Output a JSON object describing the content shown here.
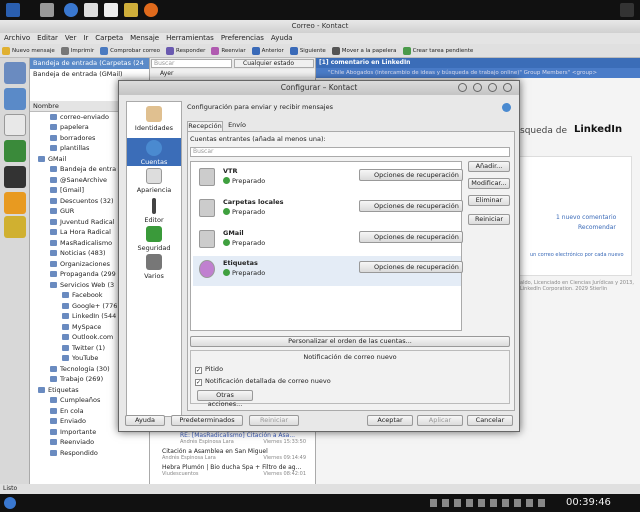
{
  "window": {
    "title": "Correo - Kontact",
    "menu": [
      "Archivo",
      "Editar",
      "Ver",
      "Ir",
      "Carpeta",
      "Mensaje",
      "Herramientas",
      "Preferencias",
      "Ayuda"
    ],
    "toolbar": [
      "Nuevo mensaje",
      "Imprimir",
      "Comprobar correo",
      "Responder",
      "Reenviar",
      "Anterior",
      "Siguiente",
      "Mover a la papelera",
      "Crear tarea pendiente"
    ]
  },
  "folder_header": "Bandeja de entrada (Carpetas",
  "folder_count": "(24",
  "folder_header2": "Bandeja de entrada (GMail)",
  "folder_col": "Nombre",
  "folders": [
    {
      "label": "correo-enviado",
      "indent": 1
    },
    {
      "label": "papelera",
      "indent": 1
    },
    {
      "label": "borradores",
      "indent": 1
    },
    {
      "label": "plantillas",
      "indent": 1
    },
    {
      "label": "GMail",
      "indent": 0
    },
    {
      "label": "Bandeja de entra",
      "indent": 1
    },
    {
      "label": "@SaneArchive",
      "indent": 1
    },
    {
      "label": "[Gmail]",
      "indent": 1
    },
    {
      "label": "Descuentos (32)",
      "indent": 1
    },
    {
      "label": "GUR",
      "indent": 1
    },
    {
      "label": "Juventud Radical",
      "indent": 1
    },
    {
      "label": "La Hora Radical",
      "indent": 1
    },
    {
      "label": "MasRadicalismo",
      "indent": 1
    },
    {
      "label": "Noticias (483)",
      "indent": 1
    },
    {
      "label": "Organizaciones",
      "indent": 1
    },
    {
      "label": "Propaganda (299",
      "indent": 1
    },
    {
      "label": "Servicios Web (3",
      "indent": 1
    },
    {
      "label": "Facebook",
      "indent": 2
    },
    {
      "label": "Google+ (776)",
      "indent": 2
    },
    {
      "label": "LinkedIn (544",
      "indent": 2
    },
    {
      "label": "MySpace",
      "indent": 2
    },
    {
      "label": "Outlook.com",
      "indent": 2
    },
    {
      "label": "Twitter (1)",
      "indent": 2
    },
    {
      "label": "YouTube",
      "indent": 2
    },
    {
      "label": "Tecnología (30)",
      "indent": 1
    },
    {
      "label": "Trabajo (269)",
      "indent": 1
    },
    {
      "label": "Etiquetas",
      "indent": 0
    },
    {
      "label": "Cumpleaños",
      "indent": 1
    },
    {
      "label": "En cola",
      "indent": 1
    },
    {
      "label": "Enviado",
      "indent": 1
    },
    {
      "label": "Importante",
      "indent": 1
    },
    {
      "label": "Reenviado",
      "indent": 1
    },
    {
      "label": "Respondido",
      "indent": 1
    }
  ],
  "search": {
    "placeholder": "Buscar",
    "state": "Cualquier estado"
  },
  "msg_group": "Ayer",
  "messages": [
    {
      "subject": "RE: [MasRadicalismo] Citación a Asa...",
      "from": "Andrés Espinosa Lara",
      "date": "Viernes 15:33:50"
    },
    {
      "subject": "Citación a Asamblea en San Miguel",
      "from": "Andrés Espinosa Lara",
      "date": "Viernes 09:14:49"
    },
    {
      "subject": "Hebra Plumón | Bio ducha Spa + Filtro de ag...",
      "from": "Viudescuentos",
      "date": "Viernes 08:42:01"
    }
  ],
  "preview": {
    "header": "[1] comentario en LinkedIn",
    "from_line": "\"Chile Abogados (intercambio de ideas y búsqueda de trabajo online)\" Group Members\" <group>",
    "search_text": "squeda de",
    "brand": "LinkedIn",
    "comment": "1 nuevo comentario",
    "recommend": "Recomendar",
    "email_pref": "un correo electrónico por cada nuevo",
    "footer": "aldo, Licenciado en Ciencias Jurídicas y 2013, LinkedIn Corporation. 2029 Stierlin"
  },
  "status": "Listo",
  "clock": "00:39:46",
  "dialog": {
    "title": "Configurar – Kontact",
    "heading": "Configuración para enviar y recibir mensajes",
    "tabs": [
      "Recepción",
      "Envío"
    ],
    "accounts_label": "Cuentas entrantes (añada al menos una):",
    "search_placeholder": "Buscar",
    "nav": [
      "Identidades",
      "Cuentas",
      "Apariencia",
      "Editor",
      "Seguridad",
      "Varios"
    ],
    "accounts": [
      {
        "name": "VTR",
        "state": "Preparado",
        "option": "Opciones de recuperación"
      },
      {
        "name": "Carpetas locales",
        "state": "Preparado",
        "option": "Opciones de recuperación"
      },
      {
        "name": "GMail",
        "state": "Preparado",
        "option": "Opciones de recuperación"
      },
      {
        "name": "Etiquetas",
        "state": "Preparado",
        "option": "Opciones de recuperación"
      }
    ],
    "side_buttons": [
      "Añadir...",
      "Modificar...",
      "Eliminar",
      "Reiniciar"
    ],
    "customize": "Personalizar el orden de las cuentas...",
    "notif_title": "Notificación de correo nuevo",
    "notif_beep": "Pitido",
    "notif_detail": "Notificación detallada de correo nuevo",
    "other_actions": "Otras acciones...",
    "footer_left": [
      "Ayuda",
      "Predeterminados",
      "Reiniciar"
    ],
    "footer_right": [
      "Aceptar",
      "Aplicar",
      "Cancelar"
    ]
  },
  "colors": {
    "accent": "#3b6db8",
    "ok": "#3fa03f"
  }
}
